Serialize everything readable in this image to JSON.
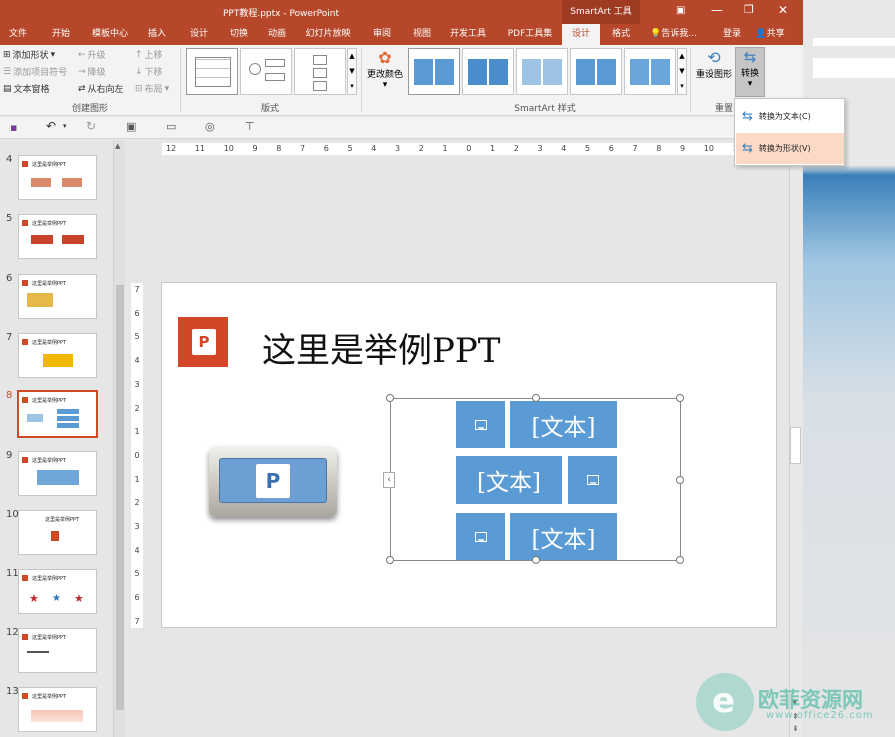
{
  "window": {
    "title": "PPT教程.pptx - PowerPoint",
    "context_tool": "SmartArt 工具",
    "login": "登录",
    "share": "共享"
  },
  "tabs": [
    {
      "label": "文件",
      "active": false
    },
    {
      "label": "开始",
      "active": false
    },
    {
      "label": "模板中心",
      "active": false
    },
    {
      "label": "插入",
      "active": false
    },
    {
      "label": "设计",
      "active": false
    },
    {
      "label": "切换",
      "active": false
    },
    {
      "label": "动画",
      "active": false
    },
    {
      "label": "幻灯片放映",
      "active": false
    },
    {
      "label": "审阅",
      "active": false
    },
    {
      "label": "视图",
      "active": false
    },
    {
      "label": "开发工具",
      "active": false
    },
    {
      "label": "PDF工具集",
      "active": false
    },
    {
      "label": "设计",
      "active": true
    },
    {
      "label": "格式",
      "active": false
    }
  ],
  "tell_me": "告诉我...",
  "ribbon": {
    "create": {
      "add_shape": "添加形状",
      "add_bullet": "添加项目符号",
      "text_pane": "文本窗格",
      "promote": "升级",
      "demote": "降级",
      "rtl": "从右向左",
      "move_up": "上移",
      "move_down": "下移",
      "layout": "布局",
      "label": "创建图形"
    },
    "layouts": {
      "label": "版式"
    },
    "styles": {
      "change_colors": "更改颜色",
      "label": "SmartArt 样式"
    },
    "reset": {
      "reset_graphic": "重设图形",
      "convert": "转换",
      "label": "重置"
    }
  },
  "convert_menu": {
    "to_text": "转换为文本(C)",
    "to_shapes": "转换为形状(V)"
  },
  "slides": [
    {
      "num": "4",
      "title": "这里是举例PPT"
    },
    {
      "num": "5",
      "title": "这里是举例PPT"
    },
    {
      "num": "6",
      "title": "这里是举例PPT"
    },
    {
      "num": "7",
      "title": "这里是举例PPT"
    },
    {
      "num": "8",
      "title": "这里是举例PPT"
    },
    {
      "num": "9",
      "title": "这里是举例PPT"
    },
    {
      "num": "10",
      "title": "这里是举例PPT"
    },
    {
      "num": "11",
      "title": "这里是举例PPT"
    },
    {
      "num": "12",
      "title": "这里是举例PPT"
    },
    {
      "num": "13",
      "title": "这里是举例PPT"
    }
  ],
  "selected_slide": "8",
  "ruler": {
    "h": [
      "12",
      "11",
      "10",
      "9",
      "8",
      "7",
      "6",
      "5",
      "4",
      "3",
      "2",
      "1",
      "0",
      "1",
      "2",
      "3",
      "4",
      "5",
      "6",
      "7",
      "8",
      "9",
      "10",
      "11",
      "12"
    ],
    "v": [
      "7",
      "6",
      "5",
      "4",
      "3",
      "2",
      "1",
      "0",
      "1",
      "2",
      "3",
      "4",
      "5",
      "6",
      "7"
    ]
  },
  "slide": {
    "title": "这里是举例PPT",
    "placeholders": [
      "[文本]",
      "[文本]",
      "[文本]"
    ],
    "logo_text": "P"
  },
  "watermark": {
    "brand": "欧菲资源网",
    "url": "www.office26.com"
  },
  "colors": {
    "accent": "#b7472a",
    "smartart": "#5b9bd5"
  }
}
